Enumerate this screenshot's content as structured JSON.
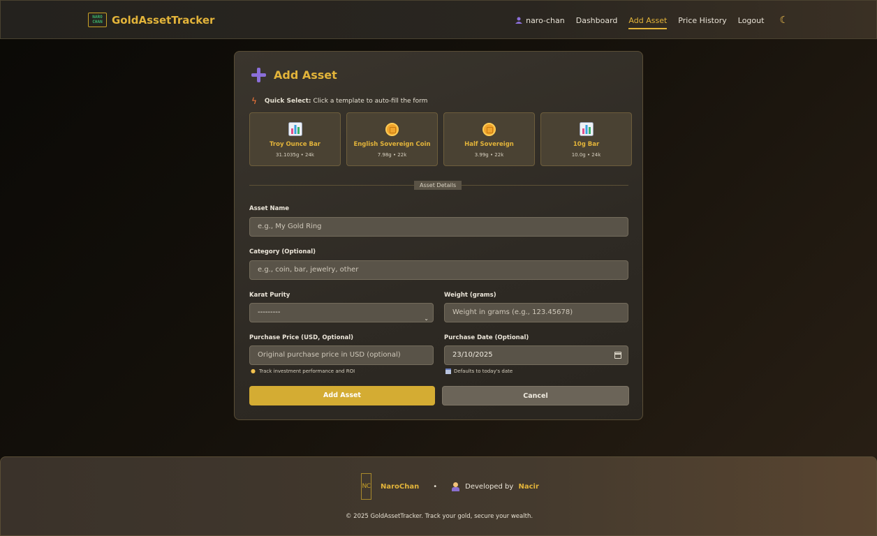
{
  "navbar": {
    "logo_text": "NARO CHAN",
    "brand": "GoldAssetTracker",
    "user": "naro-chan",
    "links": [
      "Dashboard",
      "Add Asset",
      "Price History",
      "Logout"
    ],
    "active_link": "Add Asset",
    "theme_icon": "moon-icon"
  },
  "card": {
    "title": "Add Asset",
    "quick_select_label": "Quick Select:",
    "quick_select_text": "Click a template to auto-fill the form",
    "templates": [
      {
        "name": "Troy Ounce Bar",
        "meta": "31.1035g • 24k",
        "icon": "bar-chart-icon"
      },
      {
        "name": "English Sovereign Coin",
        "meta": "7.98g • 22k",
        "icon": "coin-icon"
      },
      {
        "name": "Half Sovereign",
        "meta": "3.99g • 22k",
        "icon": "coin-icon"
      },
      {
        "name": "10g Bar",
        "meta": "10.0g • 24k",
        "icon": "bar-chart-icon"
      }
    ],
    "divider_label": "Asset Details",
    "fields": {
      "asset_name": {
        "label": "Asset Name",
        "placeholder": "e.g., My Gold Ring"
      },
      "category": {
        "label": "Category (Optional)",
        "placeholder": "e.g., coin, bar, jewelry, other"
      },
      "karat": {
        "label": "Karat Purity",
        "value": "---------"
      },
      "weight": {
        "label": "Weight (grams)",
        "placeholder": "Weight in grams (e.g., 123.45678)"
      },
      "purchase_price": {
        "label": "Purchase Price (USD, Optional)",
        "placeholder": "Original purchase price in USD (optional)",
        "hint": "Track investment performance and ROI"
      },
      "purchase_date": {
        "label": "Purchase Date (Optional)",
        "value": "23/10/2025",
        "hint": "Defaults to today's date"
      }
    },
    "buttons": {
      "submit": "Add Asset",
      "cancel": "Cancel"
    }
  },
  "footer": {
    "logo_text": "NC",
    "brand": "NaroChan",
    "separator": "•",
    "developed_by": "Developed by",
    "developer": "Nacir",
    "copyright": "© 2025 GoldAssetTracker. Track your gold, secure your wealth."
  },
  "colors": {
    "gold": "#e3b43a",
    "primary_button": "#d4ac33",
    "accent_purple": "#8b6fd9"
  }
}
